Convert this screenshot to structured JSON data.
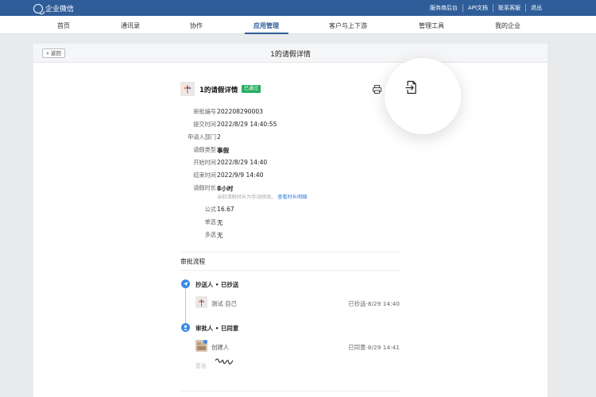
{
  "topbar": {
    "brand": "企业微信",
    "links": [
      "服务商后台",
      "API文档",
      "联系客服",
      "退出"
    ]
  },
  "nav": {
    "items": [
      "首页",
      "通讯录",
      "协作",
      "应用管理",
      "客户与上下游",
      "管理工具",
      "我的企业"
    ],
    "active_index": 3
  },
  "panel": {
    "back_label": "« 返回",
    "title": "1的请假详情"
  },
  "detail": {
    "title": "1的请假详情",
    "status_badge": "已通过",
    "fields": [
      {
        "label": "审批编号",
        "value": "202208290003"
      },
      {
        "label": "提交时间",
        "value": "2022/8/29 14:40:55"
      },
      {
        "label": "申请人部门",
        "value": "2"
      },
      {
        "label": "请假类型",
        "value": "事假"
      },
      {
        "label": "开始时间",
        "value": "2022/8/29 14:40"
      },
      {
        "label": "结束时间",
        "value": "2022/9/9 14:40"
      },
      {
        "label": "请假时长",
        "value": "8小时"
      },
      {
        "label": "公式",
        "value": "16.67"
      },
      {
        "label": "单选",
        "value": "无"
      },
      {
        "label": "多选",
        "value": "无"
      }
    ],
    "duration_hint": "当前请假时长为手动修改。",
    "duration_hint_link": "查看时长明细"
  },
  "process": {
    "section_title": "审批流程",
    "steps": [
      {
        "label": "抄送人 • 已抄送",
        "person": "测试 自己",
        "status": "已抄送·8/29 14:40"
      },
      {
        "label": "审批人 • 已同意",
        "person": "创建人",
        "status": "已同意·8/29 14:41"
      }
    ],
    "signature_label": "签名"
  },
  "icons": {
    "print": "print-icon",
    "share": "share-icon",
    "cc": "send-icon",
    "approver": "user-icon"
  },
  "colors": {
    "topbar": "#2f5d9a",
    "accent": "#3a8ae6",
    "approved": "#27ae60"
  }
}
